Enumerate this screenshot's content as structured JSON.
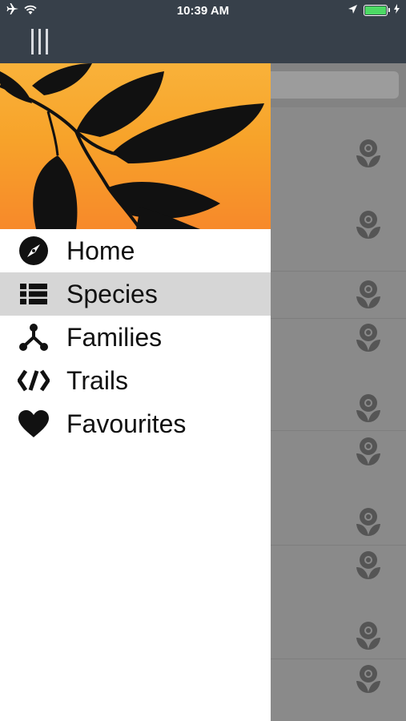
{
  "status_bar": {
    "time": "10:39 AM",
    "icons": [
      "airplane-icon",
      "wifi-icon",
      "location-icon",
      "battery-icon",
      "charging-icon"
    ]
  },
  "nav": {
    "menu_icon": "menu-icon"
  },
  "drawer": {
    "items": [
      {
        "label": "Home",
        "icon": "compass-icon",
        "selected": false
      },
      {
        "label": "Species",
        "icon": "list-icon",
        "selected": true
      },
      {
        "label": "Families",
        "icon": "tree-branch-icon",
        "selected": false
      },
      {
        "label": "Trails",
        "icon": "trail-icon",
        "selected": false
      },
      {
        "label": "Favourites",
        "icon": "heart-icon",
        "selected": false
      }
    ]
  },
  "background_list": {
    "row_icon": "flower-icon",
    "accent_colors": {
      "header_top": "#f9b23a",
      "header_bottom": "#f7892a",
      "navbar": "#37404a"
    }
  }
}
